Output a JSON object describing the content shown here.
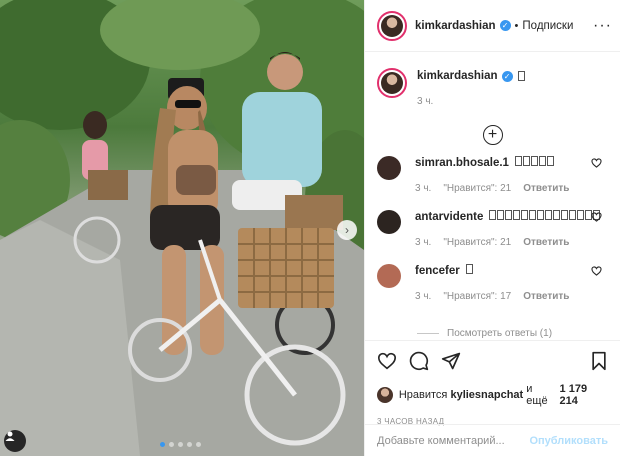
{
  "post": {
    "author": "kimkardashian",
    "verified_mark": "✓",
    "bullet": "•",
    "follow_state": "Подписки",
    "more_label": "···",
    "caption_text": "",
    "caption_time": "3 ч.",
    "load_more_symbol": "+",
    "nav_next_symbol": "›",
    "carousel_slides": 5,
    "carousel_active_index": 0
  },
  "comments": [
    {
      "user": "simran.bhosale.1",
      "boxes": 5,
      "time": "3 ч.",
      "likes": "\"Нравится\": 21",
      "reply": "Ответить",
      "avatar_color": "#3b2a26"
    },
    {
      "user": "antarvidente",
      "boxes": 14,
      "time": "3 ч.",
      "likes": "\"Нравится\": 21",
      "reply": "Ответить",
      "avatar_color": "#2c2420"
    },
    {
      "user": "fencefer",
      "boxes": 1,
      "time": "3 ч.",
      "likes": "\"Нравится\": 17",
      "reply": "Ответить",
      "avatar_color": "#b36a55"
    }
  ],
  "view_replies": "Посмотреть ответы (1)",
  "likes_line": {
    "prefix": "Нравится",
    "user": "kyliesnapchat",
    "middle": "и ещё",
    "count": "1 179 214"
  },
  "post_time": "3 ЧАСОВ НАЗАД",
  "comment_input": {
    "placeholder": "Добавьте комментарий...",
    "publish_label": "Опубликовать"
  },
  "colors": {
    "accent": "#3897f0",
    "publish_disabled": "#b2dffc",
    "meta": "#8e8e8e"
  },
  "icons": [
    "heart-icon",
    "comment-icon",
    "share-icon",
    "bookmark-icon",
    "user-tag-icon",
    "chevron-right-icon"
  ]
}
